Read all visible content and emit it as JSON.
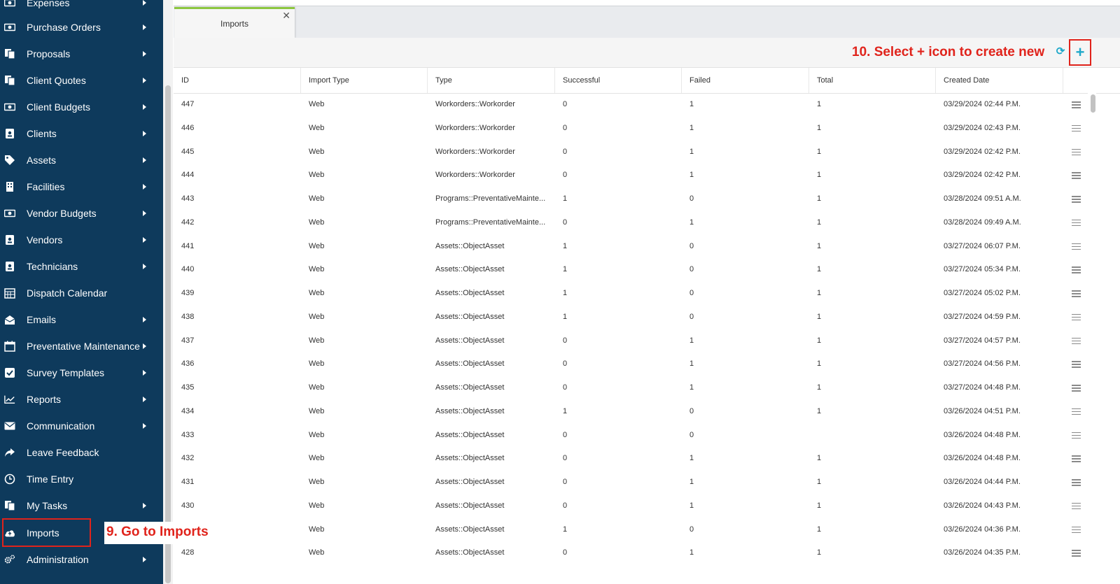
{
  "sidebar": {
    "items": [
      {
        "label": "Expenses",
        "icon": "money-icon",
        "arrow": true
      },
      {
        "label": "Purchase Orders",
        "icon": "money-icon",
        "arrow": true
      },
      {
        "label": "Proposals",
        "icon": "documents-icon",
        "arrow": true
      },
      {
        "label": "Client Quotes",
        "icon": "documents-icon",
        "arrow": true
      },
      {
        "label": "Client Budgets",
        "icon": "money-icon",
        "arrow": true
      },
      {
        "label": "Clients",
        "icon": "id-badge-icon",
        "arrow": true
      },
      {
        "label": "Assets",
        "icon": "tags-icon",
        "arrow": true
      },
      {
        "label": "Facilities",
        "icon": "building-icon",
        "arrow": true
      },
      {
        "label": "Vendor Budgets",
        "icon": "money-icon",
        "arrow": true
      },
      {
        "label": "Vendors",
        "icon": "id-badge-icon",
        "arrow": true
      },
      {
        "label": "Technicians",
        "icon": "id-badge-icon",
        "arrow": true
      },
      {
        "label": "Dispatch Calendar",
        "icon": "calendar-grid-icon",
        "arrow": false
      },
      {
        "label": "Emails",
        "icon": "envelope-open-icon",
        "arrow": true
      },
      {
        "label": "Preventative Maintenance",
        "icon": "calendar-icon",
        "arrow": true
      },
      {
        "label": "Survey Templates",
        "icon": "check-square-icon",
        "arrow": true
      },
      {
        "label": "Reports",
        "icon": "line-chart-icon",
        "arrow": true
      },
      {
        "label": "Communication",
        "icon": "envelope-icon",
        "arrow": true
      },
      {
        "label": "Leave Feedback",
        "icon": "share-icon",
        "arrow": false
      },
      {
        "label": "Time Entry",
        "icon": "clock-icon",
        "arrow": false
      },
      {
        "label": "My Tasks",
        "icon": "documents-icon",
        "arrow": true
      },
      {
        "label": "Imports",
        "icon": "cloud-upload-icon",
        "arrow": false
      },
      {
        "label": "Administration",
        "icon": "cogs-icon",
        "arrow": true
      }
    ]
  },
  "annotations": {
    "step9": "9. Go to Imports",
    "step10": "10. Select + icon to create new"
  },
  "tab": {
    "label": "Imports",
    "close": "✕"
  },
  "toolbar": {
    "refresh": "⟳",
    "add": "+"
  },
  "table": {
    "columns": [
      "ID",
      "Import Type",
      "Type",
      "Successful",
      "Failed",
      "Total",
      "Created Date"
    ],
    "rows": [
      [
        "447",
        "Web",
        "Workorders::Workorder",
        "0",
        "1",
        "1",
        "03/29/2024 02:44 P.M."
      ],
      [
        "446",
        "Web",
        "Workorders::Workorder",
        "0",
        "1",
        "1",
        "03/29/2024 02:43 P.M."
      ],
      [
        "445",
        "Web",
        "Workorders::Workorder",
        "0",
        "1",
        "1",
        "03/29/2024 02:42 P.M."
      ],
      [
        "444",
        "Web",
        "Workorders::Workorder",
        "0",
        "1",
        "1",
        "03/29/2024 02:42 P.M."
      ],
      [
        "443",
        "Web",
        "Programs::PreventativeMainte...",
        "1",
        "0",
        "1",
        "03/28/2024 09:51 A.M."
      ],
      [
        "442",
        "Web",
        "Programs::PreventativeMainte...",
        "0",
        "1",
        "1",
        "03/28/2024 09:49 A.M."
      ],
      [
        "441",
        "Web",
        "Assets::ObjectAsset",
        "1",
        "0",
        "1",
        "03/27/2024 06:07 P.M."
      ],
      [
        "440",
        "Web",
        "Assets::ObjectAsset",
        "1",
        "0",
        "1",
        "03/27/2024 05:34 P.M."
      ],
      [
        "439",
        "Web",
        "Assets::ObjectAsset",
        "1",
        "0",
        "1",
        "03/27/2024 05:02 P.M."
      ],
      [
        "438",
        "Web",
        "Assets::ObjectAsset",
        "1",
        "0",
        "1",
        "03/27/2024 04:59 P.M."
      ],
      [
        "437",
        "Web",
        "Assets::ObjectAsset",
        "0",
        "1",
        "1",
        "03/27/2024 04:57 P.M."
      ],
      [
        "436",
        "Web",
        "Assets::ObjectAsset",
        "0",
        "1",
        "1",
        "03/27/2024 04:56 P.M."
      ],
      [
        "435",
        "Web",
        "Assets::ObjectAsset",
        "0",
        "1",
        "1",
        "03/27/2024 04:48 P.M."
      ],
      [
        "434",
        "Web",
        "Assets::ObjectAsset",
        "1",
        "0",
        "1",
        "03/26/2024 04:51 P.M."
      ],
      [
        "433",
        "Web",
        "Assets::ObjectAsset",
        "0",
        "0",
        "",
        "03/26/2024 04:48 P.M."
      ],
      [
        "432",
        "Web",
        "Assets::ObjectAsset",
        "0",
        "1",
        "1",
        "03/26/2024 04:48 P.M."
      ],
      [
        "431",
        "Web",
        "Assets::ObjectAsset",
        "0",
        "1",
        "1",
        "03/26/2024 04:44 P.M."
      ],
      [
        "430",
        "Web",
        "Assets::ObjectAsset",
        "0",
        "1",
        "1",
        "03/26/2024 04:43 P.M."
      ],
      [
        "",
        "Web",
        "Assets::ObjectAsset",
        "1",
        "0",
        "1",
        "03/26/2024 04:36 P.M."
      ],
      [
        "428",
        "Web",
        "Assets::ObjectAsset",
        "0",
        "1",
        "1",
        "03/26/2024 04:35 P.M."
      ]
    ]
  }
}
